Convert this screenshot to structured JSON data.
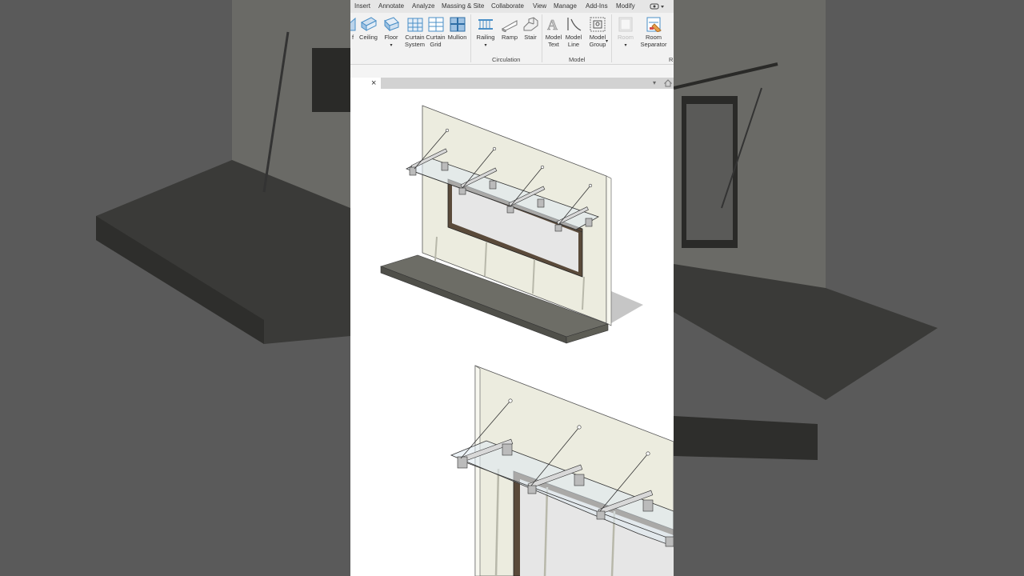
{
  "menu": [
    "Insert",
    "Annotate",
    "Analyze",
    "Massing & Site",
    "Collaborate",
    "View",
    "Manage",
    "Add-Ins",
    "Modify"
  ],
  "ribbon": {
    "buttons": [
      {
        "name": "roof",
        "label": "f",
        "icon": "roof-icon"
      },
      {
        "name": "ceiling",
        "label": "Ceiling",
        "icon": "ceiling-icon"
      },
      {
        "name": "floor",
        "label": "Floor",
        "icon": "floor-icon",
        "dropdown": "▾"
      },
      {
        "name": "curtain-system",
        "label": "Curtain System",
        "line1": "Curtain",
        "line2": "System",
        "icon": "curtain-system-icon"
      },
      {
        "name": "curtain-grid",
        "label": "Curtain Grid",
        "line1": "Curtain",
        "line2": "Grid",
        "icon": "curtain-grid-icon"
      },
      {
        "name": "mullion",
        "label": "Mullion",
        "icon": "mullion-icon"
      },
      {
        "name": "railing",
        "label": "Railing",
        "icon": "railing-icon",
        "dropdown": "▾"
      },
      {
        "name": "ramp",
        "label": "Ramp",
        "icon": "ramp-icon"
      },
      {
        "name": "stair",
        "label": "Stair",
        "icon": "stair-icon"
      },
      {
        "name": "model-text",
        "label": "Model Text",
        "line1": "Model",
        "line2": "Text",
        "icon": "model-text-icon"
      },
      {
        "name": "model-line",
        "label": "Model Line",
        "line1": "Model",
        "line2": "Line",
        "icon": "model-line-icon"
      },
      {
        "name": "model-group",
        "label": "Model Group",
        "line1": "Model",
        "line2": "Group",
        "icon": "model-group-icon",
        "dropdown": "▾"
      },
      {
        "name": "room",
        "label": "Room",
        "icon": "room-icon",
        "dropdown": "▾",
        "disabled": true
      },
      {
        "name": "room-separator",
        "label": "Room Separator",
        "line1": "Room",
        "line2": "Separator",
        "icon": "room-separator-icon"
      }
    ],
    "panels": {
      "circulation": "Circulation",
      "model": "Model",
      "room_partial": "R"
    }
  },
  "tab": {
    "close": "×",
    "dropdown": "▾"
  },
  "colors": {
    "ribbon_bg": "#f2f2f2",
    "menubar_bg": "#e6e6e6",
    "tabbar_bg": "#d2d2d2",
    "wall": "#ececdf",
    "slab": "#5d5d55",
    "icon_blue": "#4a8fc7",
    "background_gray": "#5a5a5a"
  }
}
